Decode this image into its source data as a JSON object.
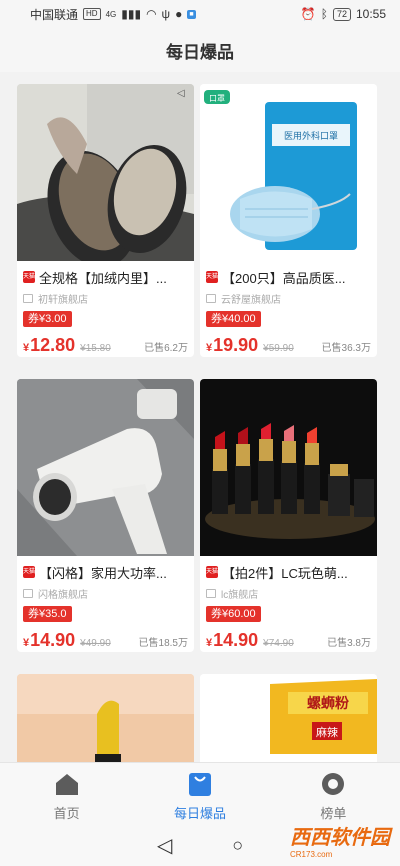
{
  "status_bar": {
    "carrier": "中国联通",
    "hd": "HD",
    "signal": "4G",
    "battery": "72",
    "time": "10:55"
  },
  "header": {
    "title": "每日爆品"
  },
  "products": [
    {
      "title": "全规格【加绒内里】...",
      "shop": "初轩旗舰店",
      "coupon": "券¥3.00",
      "price": "12.80",
      "original_price": "¥15.80",
      "sold": "已售6.2万",
      "platform_icon": "tmall-icon"
    },
    {
      "title": "【200只】高品质医...",
      "shop": "云舒屋旗舰店",
      "coupon": "券¥40.00",
      "price": "19.90",
      "original_price": "¥59.90",
      "sold": "已售36.3万",
      "platform_icon": "tmall-icon"
    },
    {
      "title": "【闪格】家用大功率...",
      "shop": "闪格旗舰店",
      "coupon": "券¥35.0",
      "price": "14.90",
      "original_price": "¥49.90",
      "sold": "已售18.5万",
      "platform_icon": "tmall-icon"
    },
    {
      "title": "【拍2件】LC玩色萌...",
      "shop": "lc旗舰店",
      "coupon": "券¥60.00",
      "price": "14.90",
      "original_price": "¥74.90",
      "sold": "已售3.8万",
      "platform_icon": "tmall-icon"
    }
  ],
  "currency_symbol": "¥",
  "product_image_texts": {
    "mask_brand": "口罩",
    "mask_pack": "医用外科口罩",
    "snack_bag": "螺蛳粉",
    "snack_flavor": "麻辣"
  },
  "bottom_nav": [
    {
      "label": "首页",
      "icon": "home-icon"
    },
    {
      "label": "每日爆品",
      "icon": "shopping-bag-icon",
      "active": true
    },
    {
      "label": "榜单",
      "icon": "ranking-icon"
    }
  ],
  "watermark": {
    "main": "西西软件园",
    "sub": "CR173.com"
  },
  "colors": {
    "accent": "#e4322b",
    "nav_active": "#2f7fe0",
    "background": "#f2f2f2"
  }
}
